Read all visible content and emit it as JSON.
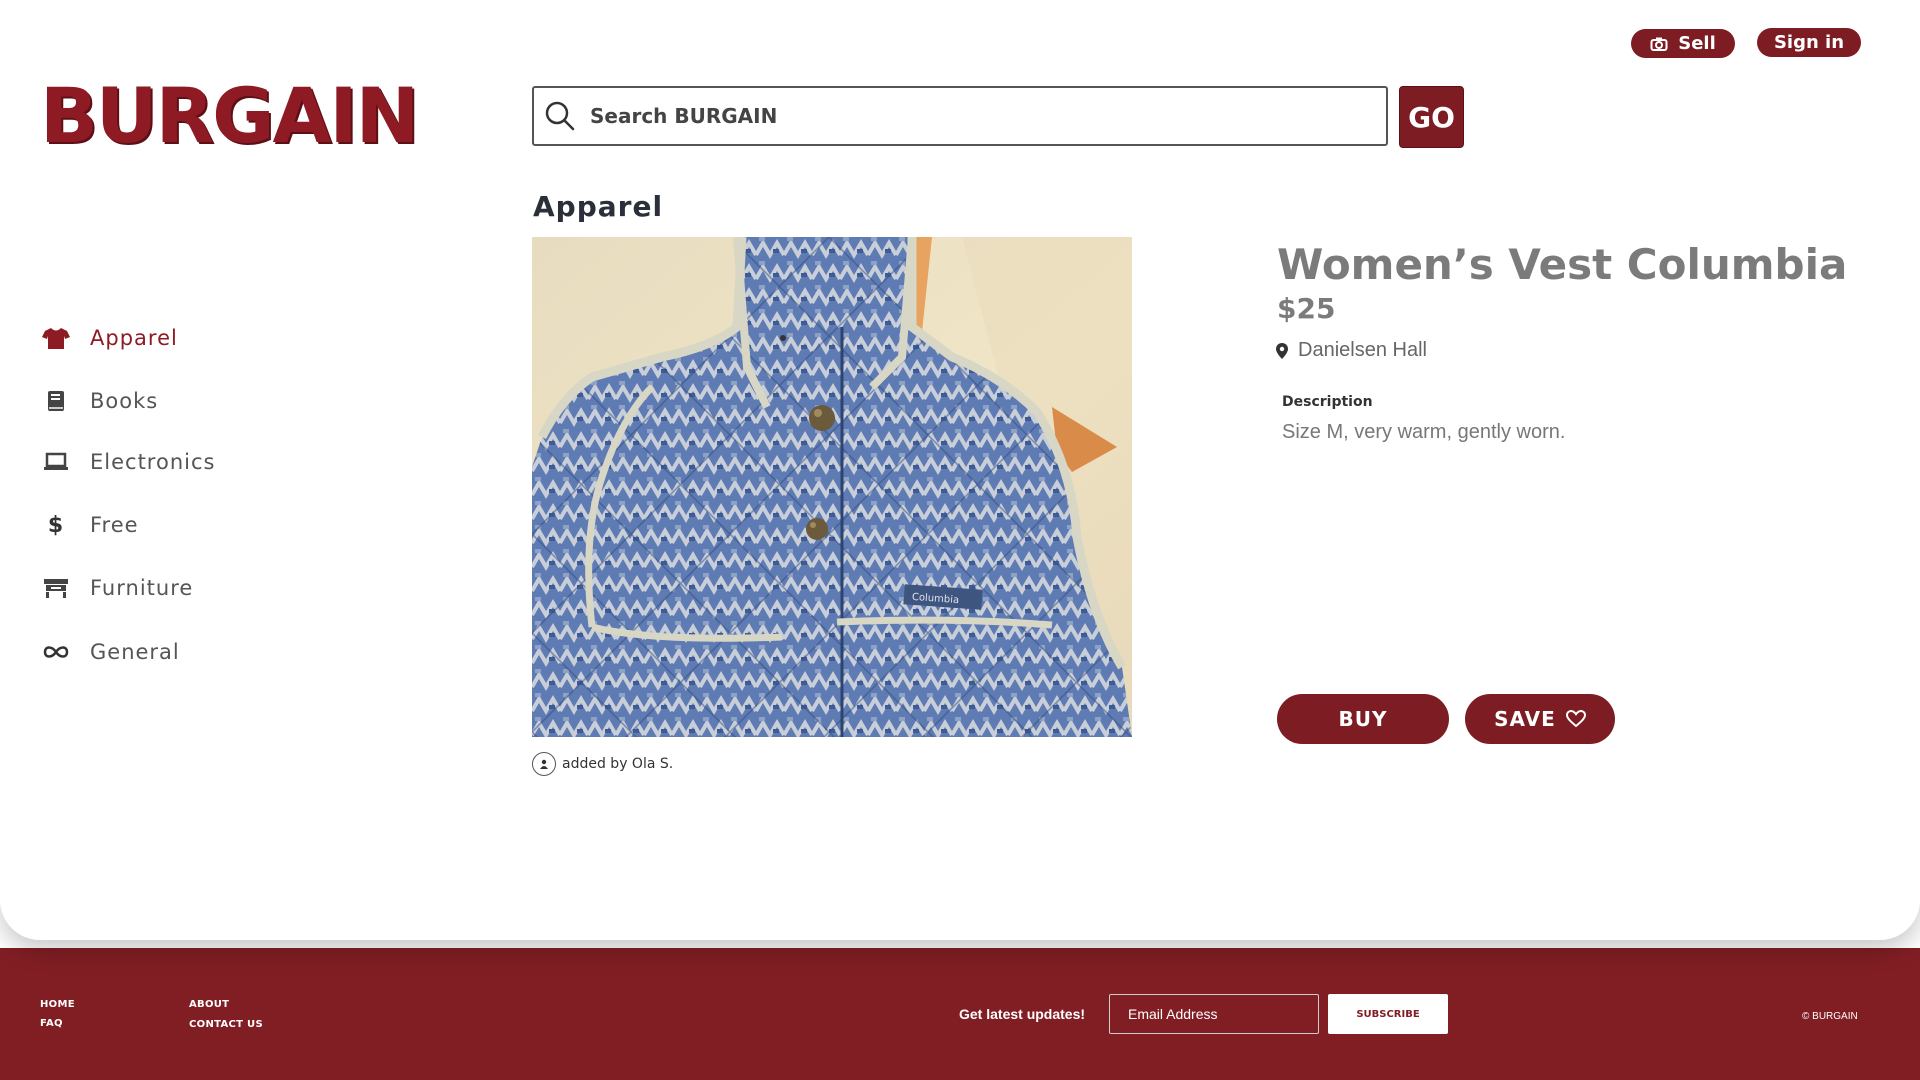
{
  "brand": {
    "logo_text": "BURGAIN",
    "accent_color": "#7d1c23"
  },
  "header": {
    "sell_label": "Sell",
    "signin_label": "Sign in",
    "search_placeholder": "Search BURGAIN",
    "go_label": "GO"
  },
  "sidebar": {
    "items": [
      {
        "label": "Apparel",
        "icon": "shirt-icon",
        "active": true
      },
      {
        "label": "Books",
        "icon": "book-icon"
      },
      {
        "label": "Electronics",
        "icon": "laptop-icon"
      },
      {
        "label": "Free",
        "icon": "dollar-icon"
      },
      {
        "label": "Furniture",
        "icon": "furniture-icon"
      },
      {
        "label": "General",
        "icon": "infinity-icon"
      }
    ]
  },
  "product": {
    "category": "Apparel",
    "title": "Women’s Vest Columbia",
    "price": "$25",
    "location": "Danielsen Hall",
    "description_label": "Description",
    "description": "Size M, very warm, gently worn.",
    "added_by": "added by Ola S.",
    "image_brand_label": "Columbia"
  },
  "actions": {
    "buy_label": "BUY",
    "save_label": "SAVE"
  },
  "footer": {
    "links": [
      "HOME",
      "FAQ",
      "ABOUT",
      "CONTACT US"
    ],
    "newsletter_label": "Get latest updates!",
    "email_placeholder": "Email Address",
    "subscribe_label": "SUBSCRIBE",
    "copyright": "© BURGAIN",
    "background_color": "#811e24"
  }
}
